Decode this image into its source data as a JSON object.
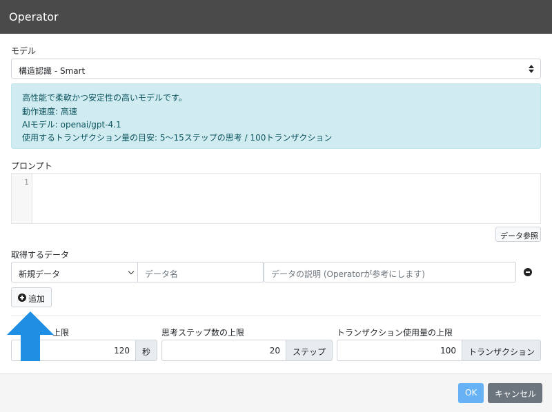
{
  "window": {
    "title": "Operator"
  },
  "model": {
    "label": "モデル",
    "selected": "構造認識 - Smart",
    "info": [
      "高性能で柔軟かつ安定性の高いモデルです。",
      "動作速度: 高速",
      "AIモデル: openai/gpt-4.1",
      "使用するトランザクション量の目安: 5〜15ステップの思考 / 100トランザクション"
    ]
  },
  "prompt": {
    "label": "プロンプト",
    "line_number": "1",
    "data_ref_button": "データ参照"
  },
  "fetch_data": {
    "label": "取得するデータ",
    "type_selected": "新規データ",
    "name_placeholder": "データ名",
    "desc_placeholder": "データの説明 (Operatorが参考にします)",
    "add_button": "追加"
  },
  "limits": {
    "time": {
      "label": "上限",
      "value": "120",
      "unit": "秒"
    },
    "steps": {
      "label": "思考ステップ数の上限",
      "value": "20",
      "unit": "ステップ"
    },
    "transactions": {
      "label": "トランザクション使用量の上限",
      "value": "100",
      "unit": "トランザクション"
    }
  },
  "footer": {
    "ok": "OK",
    "cancel": "キャンセル"
  },
  "colors": {
    "arrow": "#1e8fe3",
    "ok": "#66b2f5",
    "cancel": "#6c757d",
    "info_bg": "#d1ecf1"
  },
  "icons": {
    "arrow": "up-arrow-icon",
    "add": "plus-circle-icon",
    "remove": "minus-circle-icon"
  }
}
